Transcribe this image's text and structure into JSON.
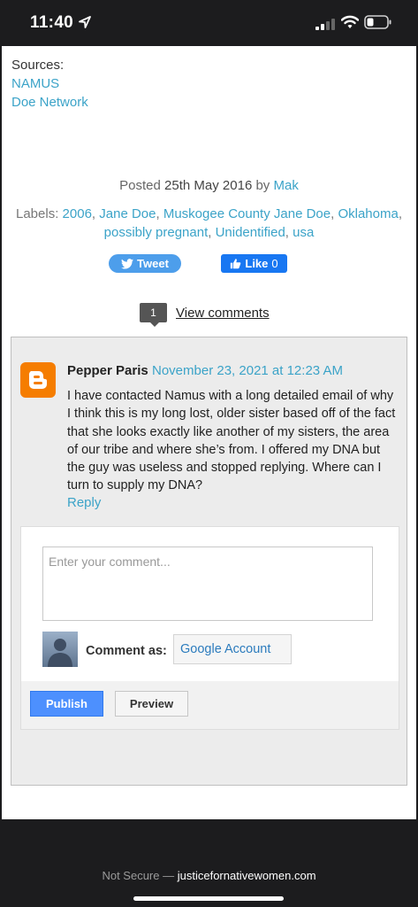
{
  "status_bar": {
    "time": "11:40"
  },
  "sources": {
    "label": "Sources:",
    "links": [
      "NAMUS",
      "Doe Network"
    ]
  },
  "post_meta": {
    "posted_prefix": "Posted",
    "date": "25th May 2016",
    "by": "by",
    "author": "Mak"
  },
  "labels": {
    "prefix": "Labels:",
    "items": [
      "2006",
      "Jane Doe",
      "Muskogee County Jane Doe",
      "Oklahoma",
      "possibly pregnant",
      "Unidentified",
      "usa"
    ]
  },
  "share": {
    "tweet_label": "Tweet",
    "like_label": "Like",
    "like_count": "0"
  },
  "comments_header": {
    "count": "1",
    "view_label": "View comments"
  },
  "comment": {
    "author": "Pepper Paris",
    "timestamp": "November 23, 2021 at 12:23 AM",
    "body": "I have contacted Namus with a long detailed email of why I think this is my long lost, older sister based off of the fact that she looks exactly like another of my sisters, the area of our tribe and where she’s from. I offered my DNA but the guy was useless and stopped replying. Where can I turn to supply my DNA?",
    "reply_label": "Reply"
  },
  "comment_form": {
    "placeholder": "Enter your comment...",
    "comment_as_label": "Comment as:",
    "account_value": "Google Account",
    "publish_label": "Publish",
    "preview_label": "Preview"
  },
  "browser_bar": {
    "security": "Not Secure —",
    "domain": "justicefornativewomen.com"
  },
  "colors": {
    "link": "#3ba3c8",
    "blogger_orange": "#f57d00",
    "publish_blue": "#4d90fe",
    "facebook_blue": "#1877f2",
    "twitter_blue": "#4d9eeb"
  }
}
